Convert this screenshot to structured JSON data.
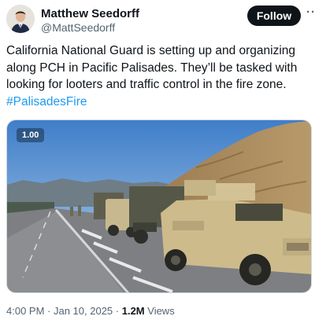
{
  "author": {
    "name": "Matthew Seedorff",
    "handle": "@MattSeedorff"
  },
  "actions": {
    "follow_label": "Follow",
    "more_label": "···"
  },
  "tweet": {
    "text": "California National Guard is setting up and organizing along PCH in Pacific Palisades.  They’ll be tasked with looking for looters and traffic control in the fire zone.",
    "hashtag": "#PalisadesFire"
  },
  "media": {
    "badge": "1.00",
    "description_icon": "photo"
  },
  "meta": {
    "time": "4:00 PM",
    "separator_1": " · ",
    "date": "Jan 10, 2025",
    "separator_2": " · ",
    "views_count": "1.2M",
    "views_label": " Views"
  },
  "colors": {
    "link": "#1d9bf0",
    "follow_bg": "#0f1419",
    "muted": "#536471"
  }
}
